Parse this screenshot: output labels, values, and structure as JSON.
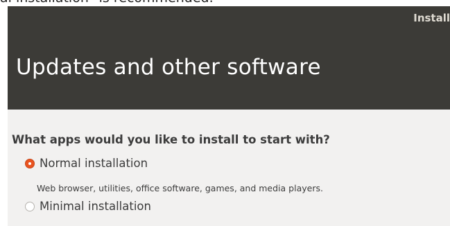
{
  "caption": {
    "text": "al installation\" is recommended."
  },
  "window": {
    "title": "Install"
  },
  "header": {
    "page_title": "Updates and other software"
  },
  "content": {
    "question": "What apps would you like to install to start with?",
    "options": [
      {
        "label": "Normal installation",
        "selected": true,
        "description": "Web browser, utilities, office software, games, and media players."
      },
      {
        "label": "Minimal installation",
        "selected": false
      }
    ]
  },
  "colors": {
    "header_background": "#3c3b37",
    "accent": "#e95420",
    "content_background": "#f2f1f0"
  }
}
